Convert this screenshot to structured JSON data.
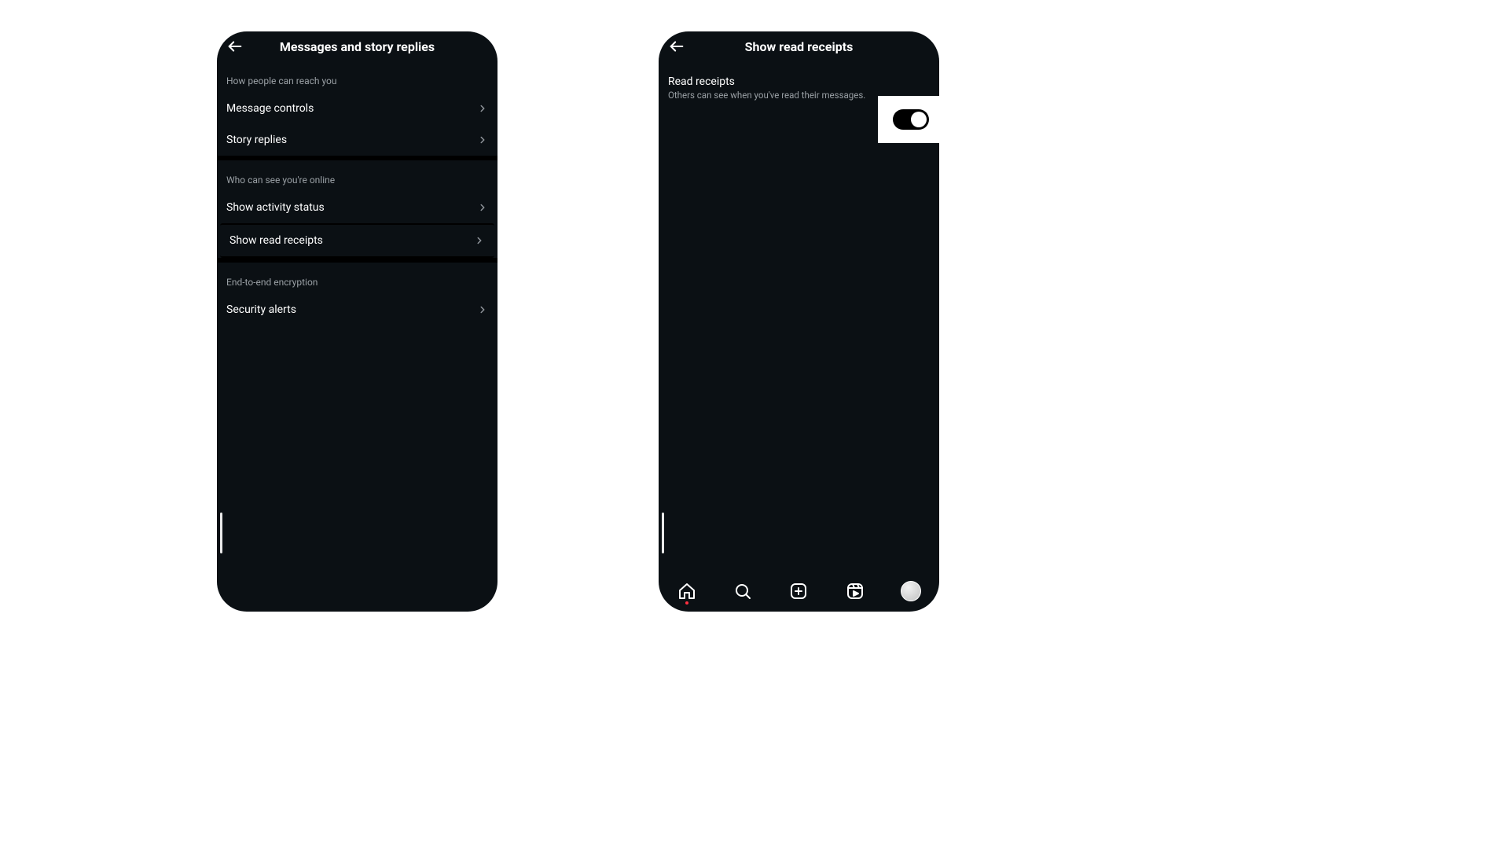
{
  "left": {
    "title": "Messages and story replies",
    "sections": [
      {
        "label": "How people can reach you",
        "items": [
          "Message controls",
          "Story replies"
        ]
      },
      {
        "label": "Who can see you're online",
        "items": [
          "Show activity status",
          "Show read receipts"
        ]
      },
      {
        "label": "End-to-end encryption",
        "items": [
          "Security alerts"
        ]
      }
    ]
  },
  "right": {
    "title": "Show read receipts",
    "setting": {
      "title": "Read receipts",
      "subtitle": "Others can see when you've read their messages.",
      "toggle_on": true
    }
  }
}
